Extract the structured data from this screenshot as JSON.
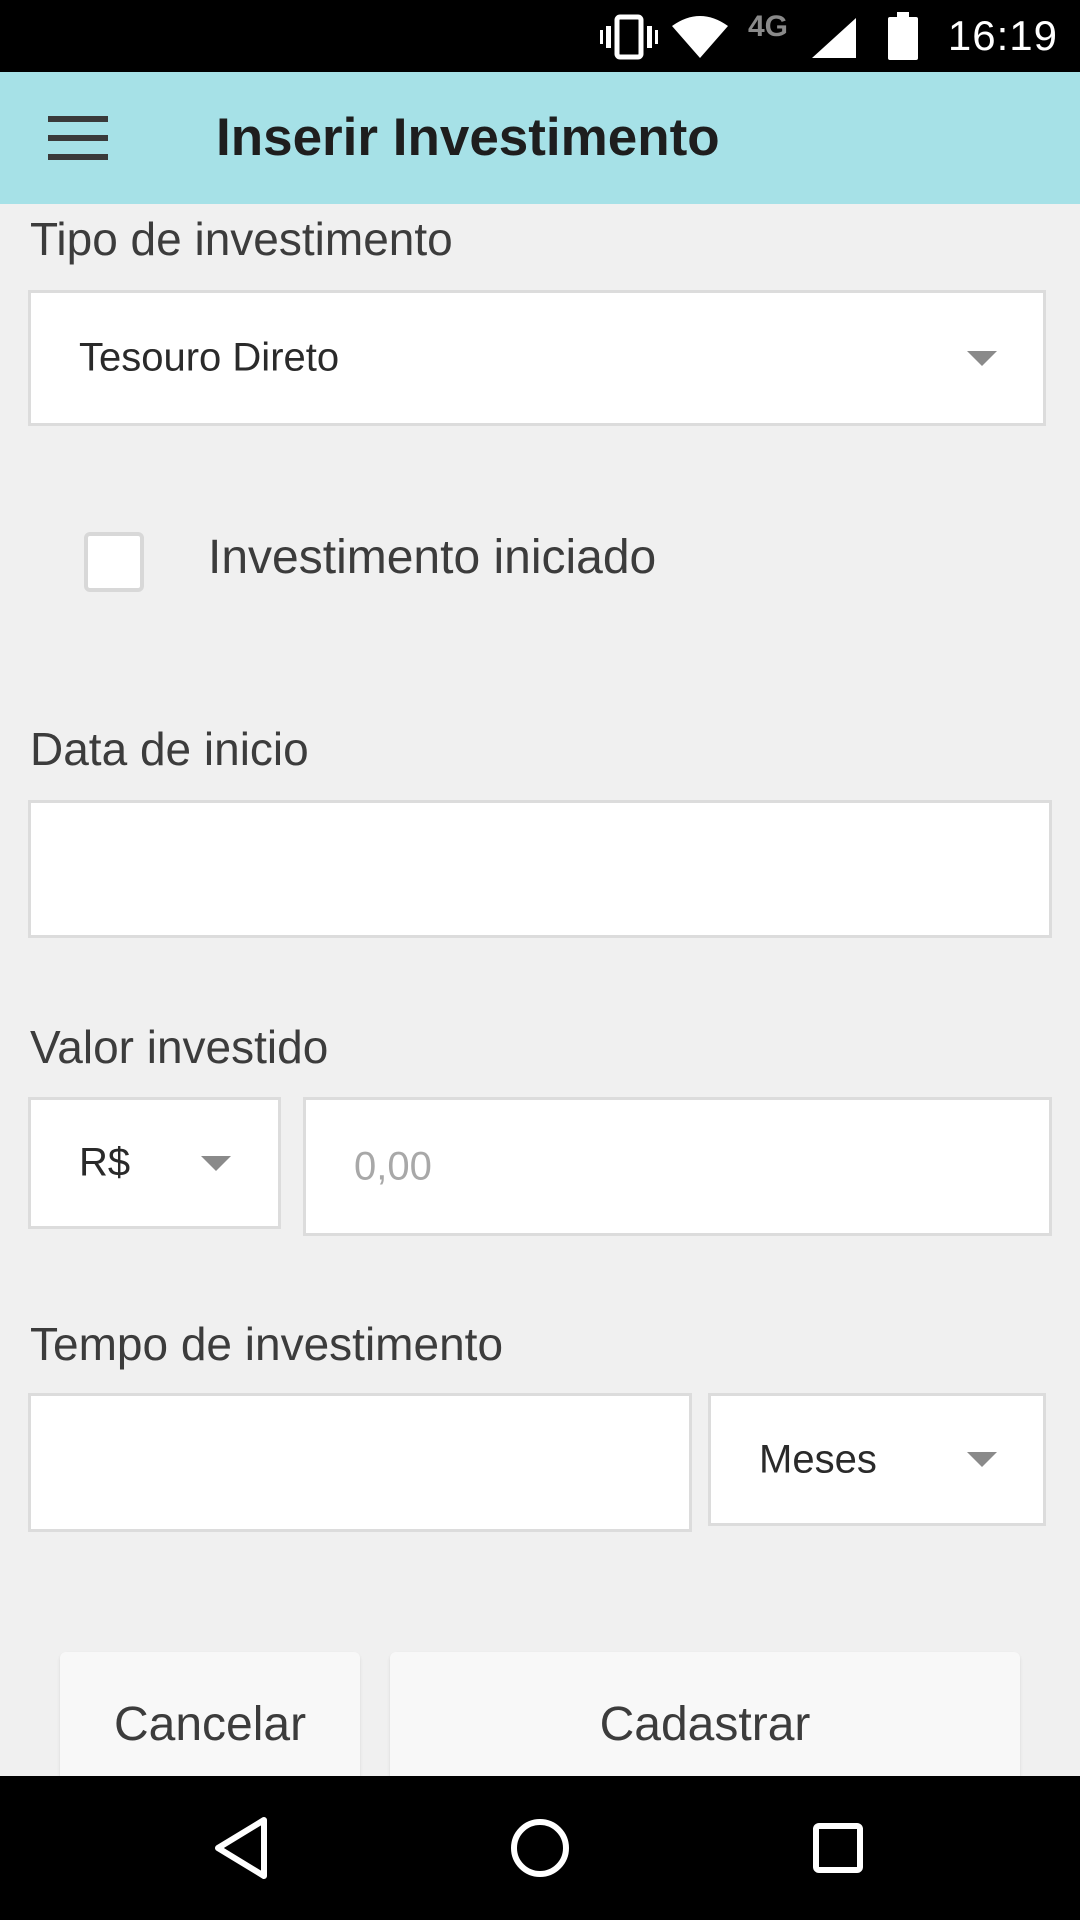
{
  "status_bar": {
    "network_label": "4G",
    "time": "16:19",
    "icons": [
      "vibrate-icon",
      "wifi-icon",
      "signal-icon",
      "battery-icon"
    ]
  },
  "app_bar": {
    "title": "Inserir Investimento",
    "menu_icon": "hamburger-menu-icon"
  },
  "form": {
    "tipo": {
      "label": "Tipo de investimento",
      "selected": "Tesouro Direto"
    },
    "iniciado": {
      "label": "Investimento iniciado",
      "checked": false
    },
    "data_inicio": {
      "label": "Data de inicio",
      "value": ""
    },
    "valor": {
      "label": "Valor investido",
      "currency": "R$",
      "placeholder": "0,00",
      "value": ""
    },
    "tempo": {
      "label": "Tempo de investimento",
      "value": "",
      "unit": "Meses"
    }
  },
  "actions": {
    "cancel_label": "Cancelar",
    "submit_label": "Cadastrar"
  },
  "nav_bar": {
    "icons": [
      "back-icon",
      "home-icon",
      "recents-icon"
    ]
  },
  "colors": {
    "app_bar": "#a6e1e7",
    "background": "#f0f0f0",
    "field_border": "#dcdcdc"
  }
}
